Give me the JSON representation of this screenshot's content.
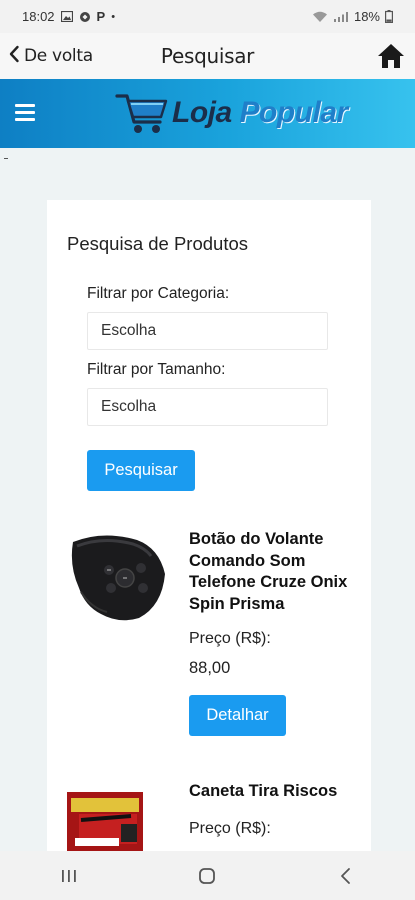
{
  "status_bar": {
    "time": "18:02",
    "p_label": "P",
    "dot": "•",
    "battery": "18%"
  },
  "nav": {
    "back_label": "De volta",
    "title": "Pesquisar"
  },
  "brand": {
    "word1": "Loja",
    "word2": "Popular"
  },
  "search": {
    "title": "Pesquisa de Produtos",
    "category_label": "Filtrar por Categoria:",
    "category_value": "Escolha",
    "size_label": "Filtrar por Tamanho:",
    "size_value": "Escolha",
    "search_button": "Pesquisar"
  },
  "products": [
    {
      "name": "Botão do Volante Comando Som Telefone Cruze Onix Spin Prisma",
      "price_label": "Preço (R$):",
      "price": "88,00",
      "details_button": "Detalhar"
    },
    {
      "name": "Caneta Tira Riscos",
      "price_label": "Preço (R$):"
    }
  ],
  "colors": {
    "accent": "#1a9bf0",
    "brand_start": "#0e7fc4",
    "brand_end": "#37c2ee"
  }
}
